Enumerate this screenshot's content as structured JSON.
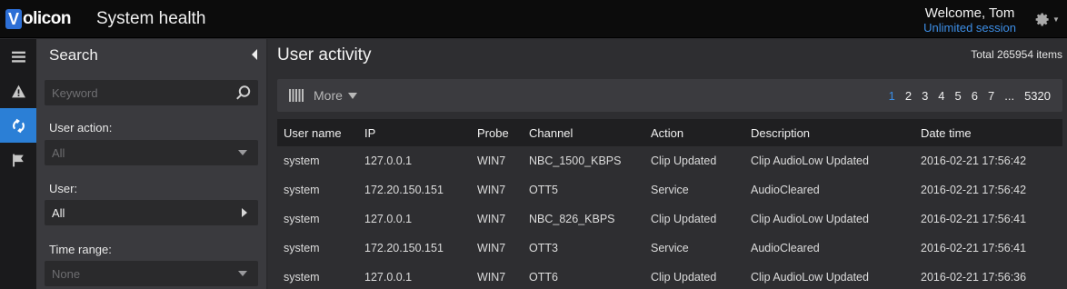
{
  "header": {
    "logo_letter": "V",
    "logo_text": "olicon",
    "app_title": "System health",
    "welcome": "Welcome, Tom",
    "session": "Unlimited session",
    "settings_icon": "gear-icon"
  },
  "rail": {
    "items": [
      {
        "name": "menu-icon"
      },
      {
        "name": "alert-icon"
      },
      {
        "name": "refresh-icon",
        "active": true
      },
      {
        "name": "flag-icon"
      }
    ]
  },
  "search": {
    "title": "Search",
    "keyword_placeholder": "Keyword",
    "user_action_label": "User action:",
    "user_action_value": "All",
    "user_label": "User:",
    "user_value": "All",
    "time_range_label": "Time range:",
    "time_range_value": "None"
  },
  "main": {
    "title": "User activity",
    "total": "Total 265954 items",
    "more_label": "More",
    "pages": [
      "1",
      "2",
      "3",
      "4",
      "5",
      "6",
      "7",
      "...",
      "5320"
    ],
    "current_page": "1",
    "columns": [
      "User name",
      "IP",
      "Probe",
      "Channel",
      "Action",
      "Description",
      "Date time"
    ],
    "rows": [
      [
        "system",
        "127.0.0.1",
        "WIN7",
        "NBC_1500_KBPS",
        "Clip Updated",
        "Clip AudioLow Updated",
        "2016-02-21 17:56:42"
      ],
      [
        "system",
        "172.20.150.151",
        "WIN7",
        "OTT5",
        "Service",
        "AudioCleared",
        "2016-02-21 17:56:42"
      ],
      [
        "system",
        "127.0.0.1",
        "WIN7",
        "NBC_826_KBPS",
        "Clip Updated",
        "Clip AudioLow Updated",
        "2016-02-21 17:56:41"
      ],
      [
        "system",
        "172.20.150.151",
        "WIN7",
        "OTT3",
        "Service",
        "AudioCleared",
        "2016-02-21 17:56:41"
      ],
      [
        "system",
        "127.0.0.1",
        "WIN7",
        "OTT6",
        "Clip Updated",
        "Clip AudioLow Updated",
        "2016-02-21 17:56:36"
      ]
    ]
  },
  "colors": {
    "accent": "#2b7fd6",
    "link": "#3d8ee6"
  }
}
